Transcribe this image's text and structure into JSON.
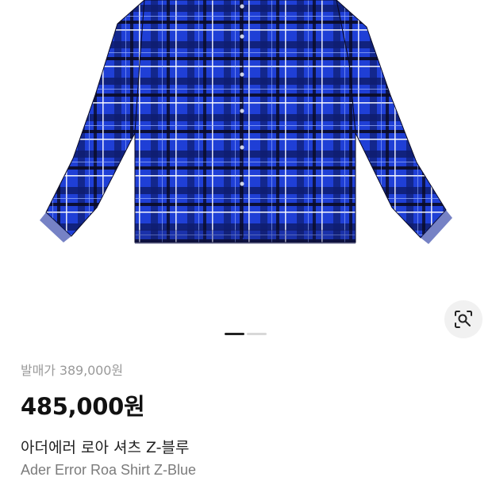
{
  "product": {
    "release_label": "발매가",
    "release_price": "389,000원",
    "price": "485,000원",
    "title_ko": "아더에러 로아 셔츠 Z-블루",
    "title_en": "Ader Error Roa Shirt Z-Blue"
  },
  "gallery": {
    "image_icon": "plaid-shirt-image",
    "lens_icon": "image-search-icon",
    "pager_total": 2,
    "pager_active": 1
  },
  "colors": {
    "shirt_blue": "#1f3fd6",
    "plaid_dark": "#0b0b2a",
    "plaid_light": "#ffffff",
    "pager_active": "#222222",
    "pager_inactive": "#d8d8d8"
  }
}
